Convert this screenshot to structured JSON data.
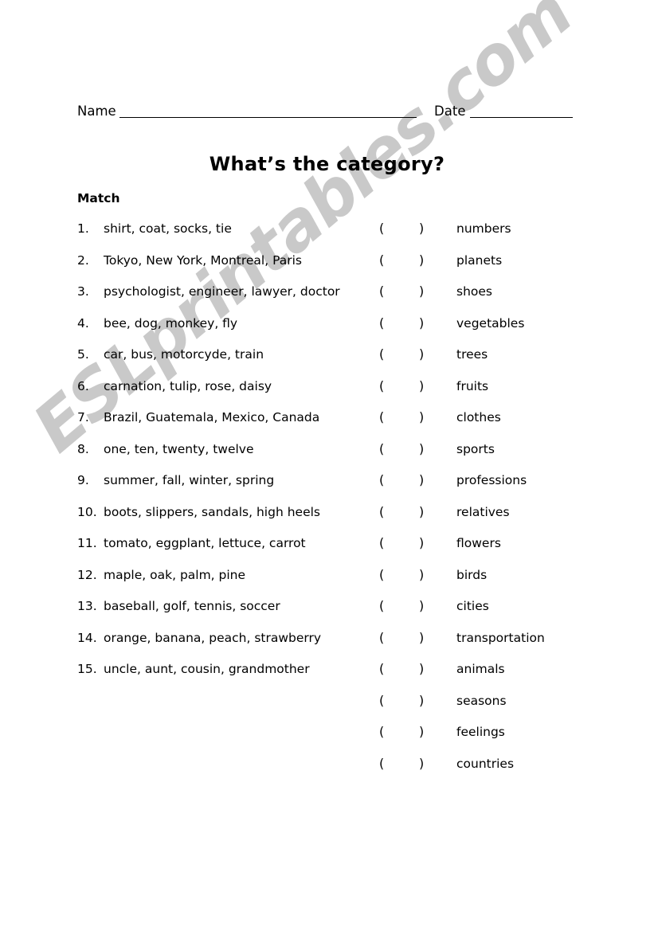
{
  "page": {
    "title": "What’s the category?",
    "instruction": "Match",
    "background_color": "#ffffff",
    "text_color": "#000000"
  },
  "header": {
    "name_label": "Name",
    "date_label": "Date"
  },
  "watermark": {
    "text": "ESLprintables.com",
    "color": "#c9c9c9",
    "rotation_deg": -40
  },
  "blank": {
    "open": "(",
    "close": ")"
  },
  "items": [
    {
      "number": "1.",
      "text": "shirt, coat, socks, tie"
    },
    {
      "number": "2.",
      "text": "Tokyo, New York, Montreal, Paris"
    },
    {
      "number": "3.",
      "text": "psychologist, engineer, lawyer, doctor"
    },
    {
      "number": "4.",
      "text": "bee, dog, monkey, fly"
    },
    {
      "number": "5.",
      "text": "car, bus, motorcyde, train"
    },
    {
      "number": "6.",
      "text": "carnation, tulip, rose, daisy"
    },
    {
      "number": "7.",
      "text": "Brazil, Guatemala, Mexico, Canada"
    },
    {
      "number": "8.",
      "text": "one, ten, twenty, twelve"
    },
    {
      "number": "9.",
      "text": "summer, fall, winter, spring"
    },
    {
      "number": "10.",
      "text": "boots, slippers, sandals, high heels"
    },
    {
      "number": "11.",
      "text": "tomato, eggplant, lettuce, carrot"
    },
    {
      "number": "12.",
      "text": "maple, oak, palm, pine"
    },
    {
      "number": "13.",
      "text": "baseball, golf, tennis, soccer"
    },
    {
      "number": "14.",
      "text": "orange, banana, peach, strawberry"
    },
    {
      "number": "15.",
      "text": "uncle, aunt, cousin, grandmother"
    }
  ],
  "categories": [
    {
      "label": "numbers"
    },
    {
      "label": "planets"
    },
    {
      "label": "shoes"
    },
    {
      "label": "vegetables"
    },
    {
      "label": "trees"
    },
    {
      "label": "fruits"
    },
    {
      "label": "clothes"
    },
    {
      "label": "sports"
    },
    {
      "label": "professions"
    },
    {
      "label": "relatives"
    },
    {
      "label": "flowers"
    },
    {
      "label": "birds"
    },
    {
      "label": "cities"
    },
    {
      "label": "transportation"
    },
    {
      "label": "animals"
    },
    {
      "label": "seasons"
    },
    {
      "label": "feelings"
    },
    {
      "label": "countries"
    }
  ]
}
